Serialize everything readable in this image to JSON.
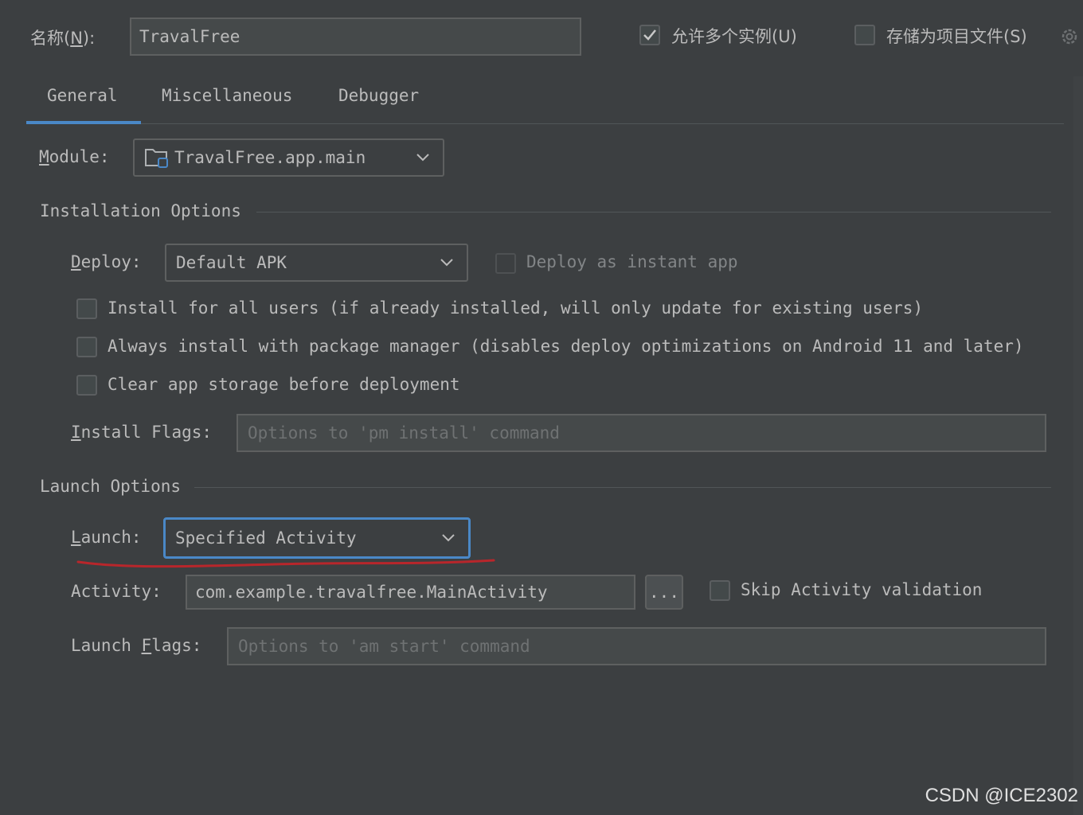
{
  "header": {
    "name_label": "名称(",
    "name_mnemonic": "N",
    "name_label_end": "):",
    "name_value": "TravalFree",
    "allow_multiple_label": "允许多个实例(U)",
    "allow_multiple_checked": true,
    "store_as_project_label": "存储为项目文件(S)",
    "store_as_project_checked": false
  },
  "tabs": [
    "General",
    "Miscellaneous",
    "Debugger"
  ],
  "general": {
    "module_mnemonic": "M",
    "module_label_rest": "odule:",
    "module_value": "TravalFree.app.main",
    "installation_options": {
      "title": "Installation Options",
      "deploy_mnemonic": "D",
      "deploy_label_rest": "eploy:",
      "deploy_value": "Default APK",
      "deploy_instant_label": "Deploy as instant app",
      "checkboxes": [
        "Install for all users (if already installed, will only update for existing users)",
        "Always install with package manager (disables deploy optimizations on Android 11 and later)",
        "Clear app storage before deployment"
      ],
      "install_flags_mnemonic": "I",
      "install_flags_label_rest": "nstall Flags:",
      "install_flags_placeholder": "Options to 'pm install' command"
    },
    "launch_options": {
      "title": "Launch Options",
      "launch_mnemonic": "L",
      "launch_label_rest": "aunch:",
      "launch_value": "Specified Activity",
      "activity_label": "Activity:",
      "activity_value": "com.example.travalfree.MainActivity",
      "browse_label": "...",
      "skip_validation_label": "Skip Activity validation",
      "launch_flags_label_start": "Launch ",
      "launch_flags_mnemonic": "F",
      "launch_flags_label_rest": "lags:",
      "launch_flags_placeholder": "Options to 'am start' command"
    }
  },
  "watermark": "CSDN @ICE2302",
  "colors": {
    "background": "#3c3f41",
    "accent": "#4a88c7",
    "annotation": "#b8262b",
    "text": "#bbbbbb"
  }
}
